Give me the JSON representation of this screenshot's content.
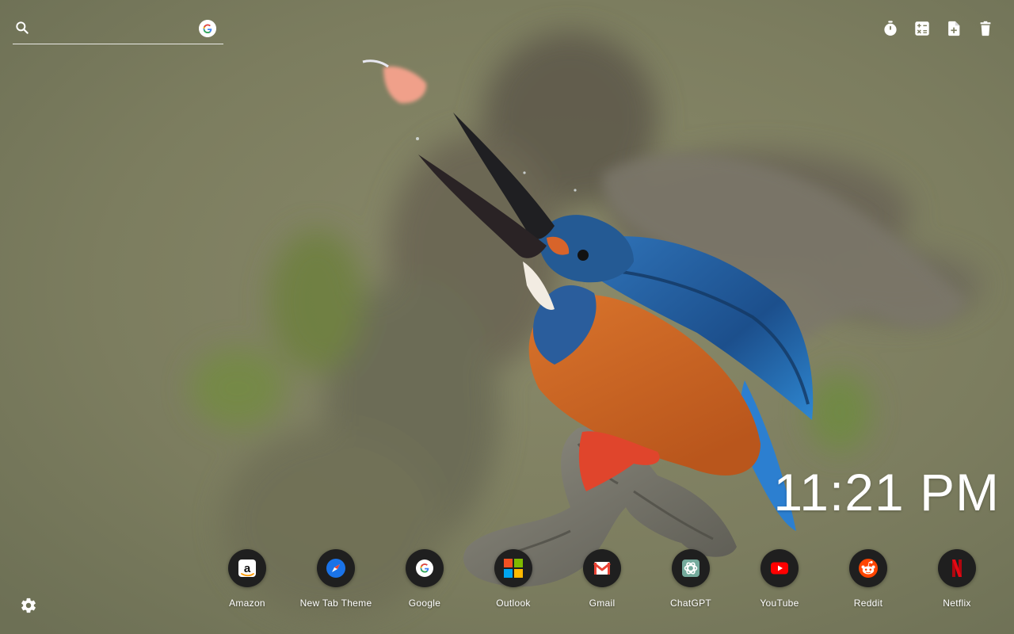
{
  "search": {
    "placeholder": "",
    "value": "",
    "engine_icon": "google-icon"
  },
  "toolbar": {
    "items": [
      {
        "name": "timer",
        "icon": "stopwatch-icon"
      },
      {
        "name": "calculator",
        "icon": "calculator-icon"
      },
      {
        "name": "new-note",
        "icon": "file-plus-icon"
      },
      {
        "name": "delete",
        "icon": "trash-icon"
      }
    ]
  },
  "clock": {
    "time": "11:21 PM"
  },
  "shortcuts": [
    {
      "label": "Amazon",
      "icon": "amazon-icon",
      "color": "#ff9900"
    },
    {
      "label": "New Tab Theme",
      "icon": "compass-icon",
      "color": "#1a73e8"
    },
    {
      "label": "Google",
      "icon": "google-icon",
      "color": "#4285f4"
    },
    {
      "label": "Outlook",
      "icon": "microsoft-icon",
      "color": "#f25022"
    },
    {
      "label": "Gmail",
      "icon": "gmail-icon",
      "color": "#ea4335"
    },
    {
      "label": "ChatGPT",
      "icon": "chatgpt-icon",
      "color": "#74aa9c"
    },
    {
      "label": "YouTube",
      "icon": "youtube-icon",
      "color": "#ff0000"
    },
    {
      "label": "Reddit",
      "icon": "reddit-icon",
      "color": "#ff4500"
    },
    {
      "label": "Netflix",
      "icon": "netflix-icon",
      "color": "#e50914"
    }
  ],
  "settings": {
    "icon": "gear-icon"
  },
  "colors": {
    "background": "#7b7c5e",
    "text": "#ffffff",
    "shortcut_circle": "#1f1f1f"
  }
}
